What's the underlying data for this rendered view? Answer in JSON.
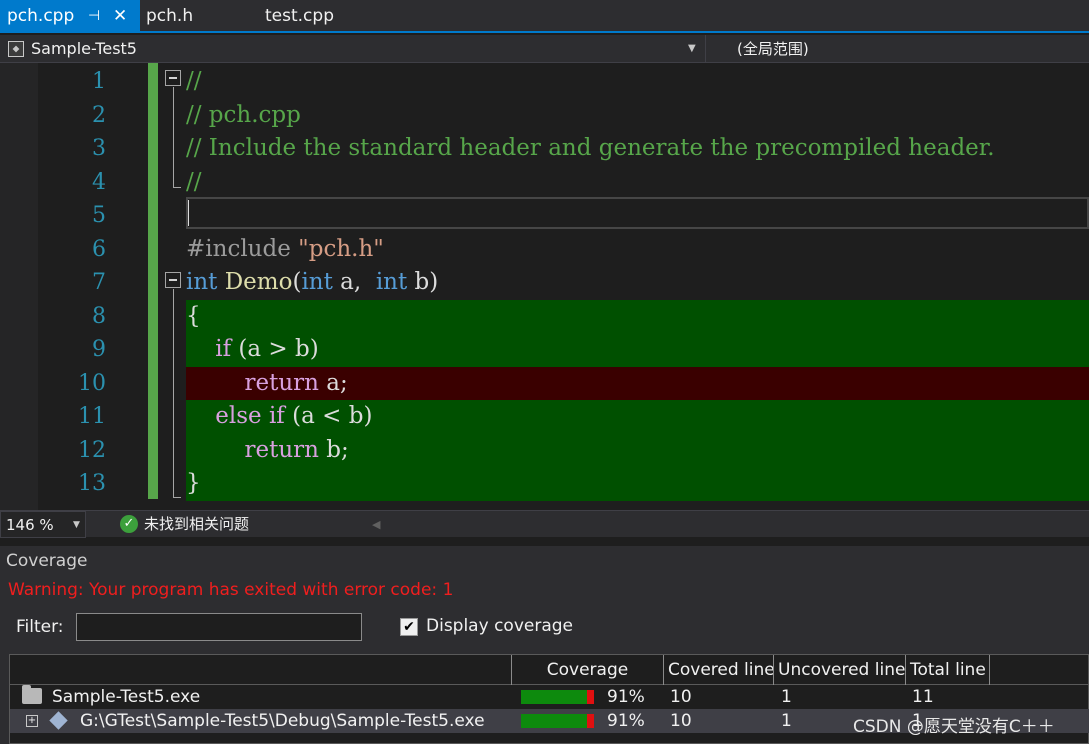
{
  "tabs": [
    {
      "label": "pch.cpp",
      "active": true,
      "pin_icon": "pin-icon",
      "close_icon": "close-icon"
    },
    {
      "label": "pch.h",
      "active": false
    },
    {
      "label": "test.cpp",
      "active": false
    }
  ],
  "navbar": {
    "project": "Sample-Test5",
    "scope": "(全局范围)"
  },
  "editor": {
    "line_numbers": [
      "1",
      "2",
      "3",
      "4",
      "5",
      "6",
      "7",
      "8",
      "9",
      "10",
      "11",
      "12",
      "13"
    ],
    "lines": [
      {
        "tokens": [
          [
            "c-com",
            "//"
          ]
        ]
      },
      {
        "tokens": [
          [
            "c-com",
            "// pch.cpp"
          ]
        ]
      },
      {
        "tokens": [
          [
            "c-com",
            "// Include the standard header and generate the precompiled header."
          ]
        ]
      },
      {
        "tokens": [
          [
            "c-com",
            "//"
          ]
        ]
      },
      {
        "tokens": []
      },
      {
        "tokens": [
          [
            "c-pp",
            "#include "
          ],
          [
            "c-str",
            "\"pch.h\""
          ]
        ]
      },
      {
        "tokens": [
          [
            "c-kw",
            "int"
          ],
          [
            "c-tx",
            " "
          ],
          [
            "c-fn",
            "Demo"
          ],
          [
            "c-tx",
            "("
          ],
          [
            "c-kw",
            "int"
          ],
          [
            "c-tx",
            " a,  "
          ],
          [
            "c-kw",
            "int"
          ],
          [
            "c-tx",
            " b)"
          ]
        ]
      },
      {
        "tokens": [
          [
            "c-tx",
            "{"
          ]
        ],
        "coverage": "covered"
      },
      {
        "tokens": [
          [
            "c-tx",
            "    "
          ],
          [
            "c-kw2",
            "if"
          ],
          [
            "c-tx",
            " (a > b)"
          ]
        ],
        "coverage": "covered"
      },
      {
        "tokens": [
          [
            "c-tx",
            "        "
          ],
          [
            "c-kw2",
            "return"
          ],
          [
            "c-tx",
            " a;"
          ]
        ],
        "coverage": "uncovered"
      },
      {
        "tokens": [
          [
            "c-tx",
            "    "
          ],
          [
            "c-kw2",
            "else"
          ],
          [
            "c-tx",
            " "
          ],
          [
            "c-kw2",
            "if"
          ],
          [
            "c-tx",
            " (a < b)"
          ]
        ],
        "coverage": "covered"
      },
      {
        "tokens": [
          [
            "c-tx",
            "        "
          ],
          [
            "c-kw2",
            "return"
          ],
          [
            "c-tx",
            " b;"
          ]
        ],
        "coverage": "covered"
      },
      {
        "tokens": [
          [
            "c-tx",
            "}"
          ]
        ],
        "coverage": "covered"
      }
    ]
  },
  "status": {
    "zoom": "146 %",
    "issues": "未找到相关问题",
    "ok_icon": "check-circle-icon"
  },
  "coverage": {
    "title": "Coverage",
    "warning": "Warning: Your program has exited with error code: 1",
    "filter_label": "Filter:",
    "filter_value": "",
    "display_coverage_label": "Display coverage",
    "display_coverage_checked": true,
    "columns": [
      "",
      "Coverage",
      "Covered line",
      "Uncovered line",
      "Total line"
    ],
    "rows": [
      {
        "icon": "folder-icon",
        "name": "Sample-Test5.exe",
        "coverage_fraction": 0.91,
        "coverage_text": "91%",
        "covered": "10",
        "uncovered": "1",
        "total": "11",
        "selected": false
      },
      {
        "icon": "module-icon",
        "name": "G:\\GTest\\Sample-Test5\\Debug\\Sample-Test5.exe",
        "coverage_fraction": 0.91,
        "coverage_text": "91%",
        "covered": "10",
        "uncovered": "1",
        "total": "1",
        "selected": true
      }
    ],
    "colors": {
      "covered": "#0d8a0d",
      "uncovered": "#e01010",
      "warning": "#f01e1e"
    }
  },
  "watermark": "CSDN @愿天堂没有C＋＋"
}
